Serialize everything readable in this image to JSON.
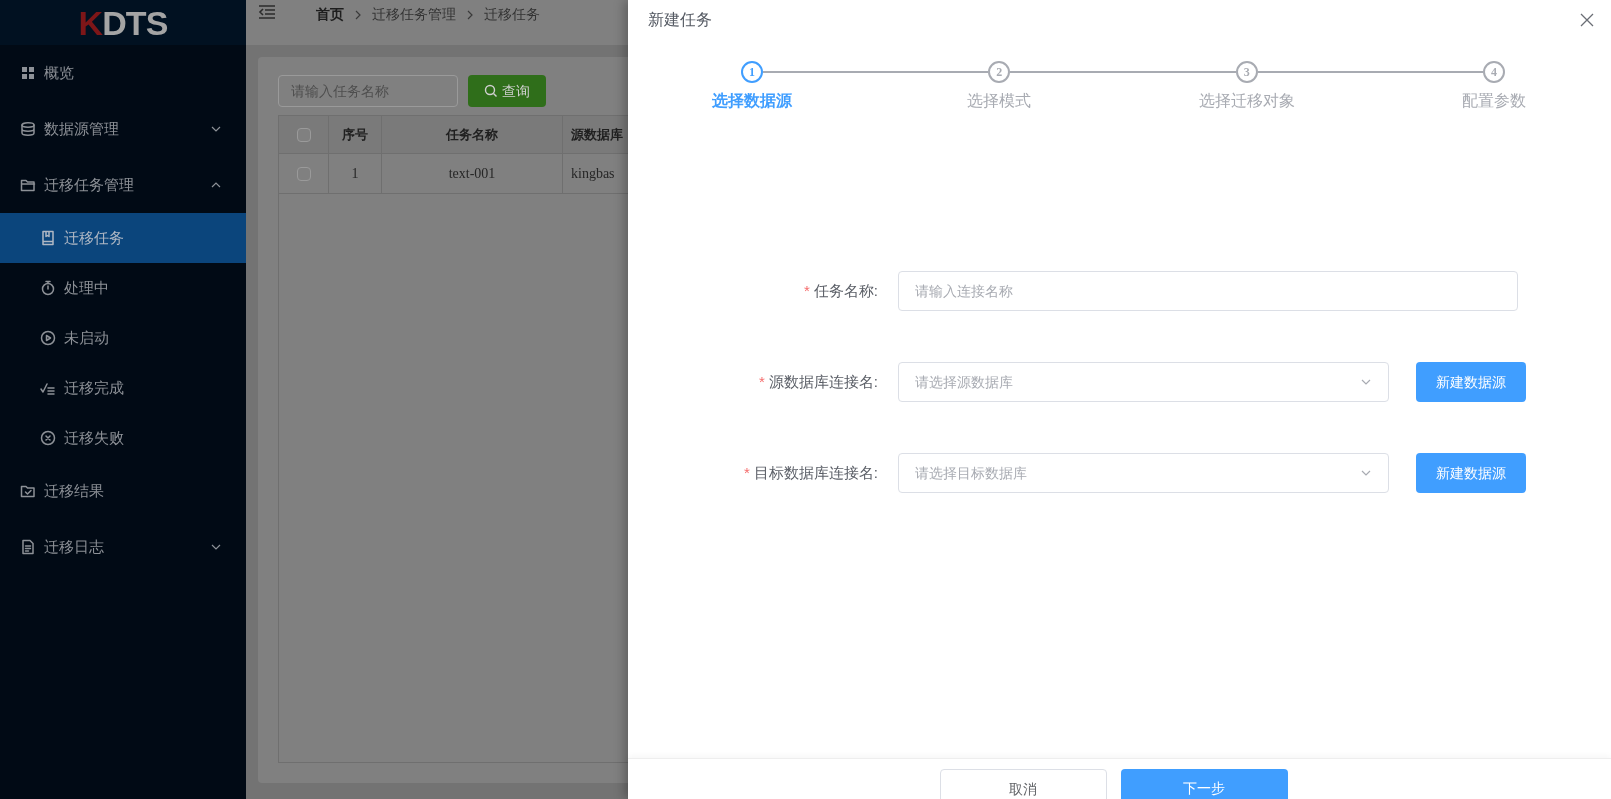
{
  "logo": {
    "mark": "K",
    "text": "DTS"
  },
  "sidebar": {
    "items": [
      {
        "label": "概览",
        "selected": false
      },
      {
        "label": "数据源管理",
        "expanded": false,
        "selected": false
      },
      {
        "label": "迁移任务管理",
        "expanded": true,
        "selected": false,
        "children": [
          {
            "label": "迁移任务",
            "selected": true
          },
          {
            "label": "处理中",
            "selected": false
          },
          {
            "label": "未启动",
            "selected": false
          },
          {
            "label": "迁移完成",
            "selected": false
          },
          {
            "label": "迁移失败",
            "selected": false
          }
        ]
      },
      {
        "label": "迁移结果",
        "selected": false
      },
      {
        "label": "迁移日志",
        "expanded": false,
        "selected": false
      }
    ]
  },
  "breadcrumb": [
    "首页",
    "迁移任务管理",
    "迁移任务"
  ],
  "search": {
    "placeholder": "请输入任务名称",
    "button": "查询"
  },
  "table": {
    "header_checked": false,
    "columns": [
      "序号",
      "任务名称",
      "源数据库"
    ],
    "rows": [
      {
        "checked": false,
        "cells": [
          "1",
          "text-001",
          "kingbas"
        ]
      }
    ]
  },
  "drawer": {
    "title": "新建任务",
    "steps": [
      {
        "number": "1",
        "label": "选择数据源",
        "selected": true
      },
      {
        "number": "2",
        "label": "选择模式",
        "selected": false
      },
      {
        "number": "3",
        "label": "选择迁移对象",
        "selected": false
      },
      {
        "number": "4",
        "label": "配置参数",
        "selected": false
      }
    ],
    "fields": [
      {
        "kind": "input",
        "mark": "*",
        "label": "任务名称:",
        "placeholder": "请输入连接名称"
      },
      {
        "kind": "select",
        "mark": "*",
        "label": "源数据库连接名:",
        "placeholder": "请选择源数据库",
        "button": "新建数据源"
      },
      {
        "kind": "select",
        "mark": "*",
        "label": "目标数据库连接名:",
        "placeholder": "请选择目标数据库",
        "button": "新建数据源"
      }
    ],
    "buttons": [
      {
        "label": "取消",
        "kind": "default"
      },
      {
        "label": "下一步",
        "kind": "primary"
      }
    ]
  }
}
